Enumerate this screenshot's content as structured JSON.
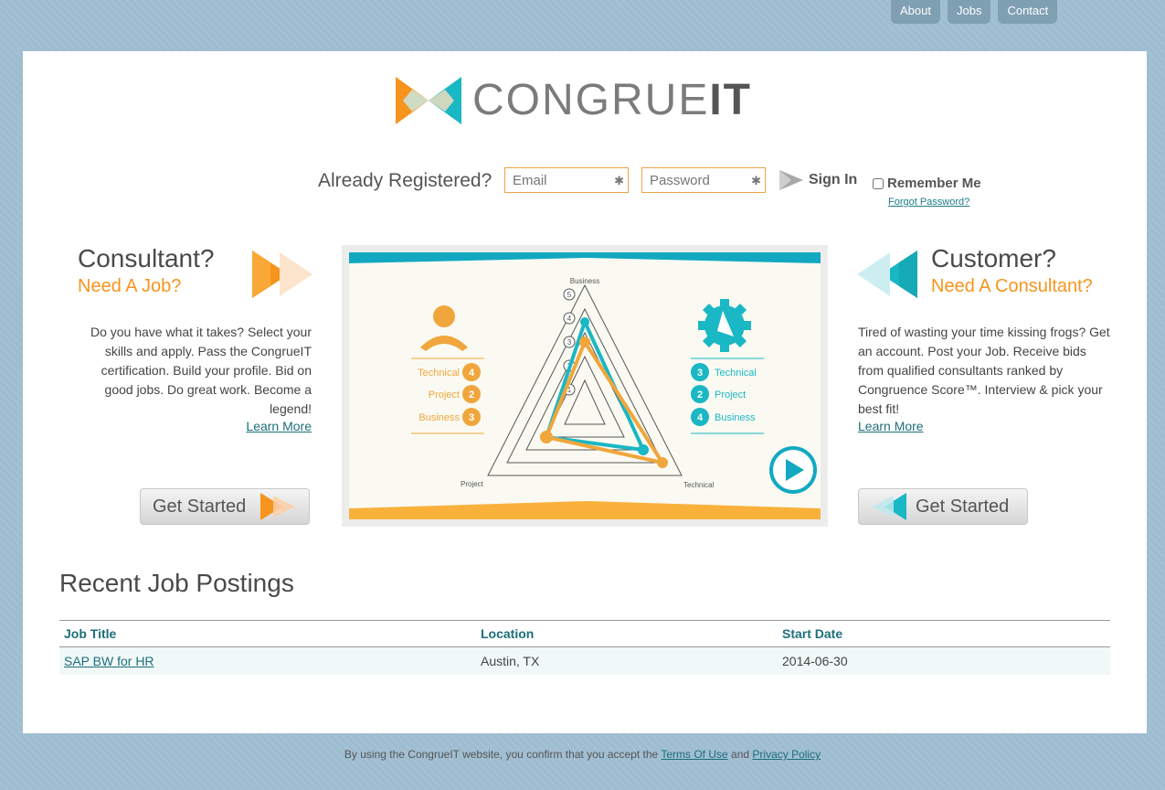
{
  "nav": [
    "About",
    "Jobs",
    "Contact"
  ],
  "logo": {
    "prefix": "CONGRUE",
    "suffix": "IT"
  },
  "login": {
    "prompt": "Already Registered?",
    "email_placeholder": "Email",
    "password_placeholder": "Password",
    "signin_label": "Sign In",
    "remember_label": "Remember Me",
    "forgot_label": "Forgot Password?"
  },
  "consultant": {
    "title": "Consultant?",
    "subtitle": "Need A Job?",
    "description": "Do you have what it takes? Select your skills and apply. Pass the CongrueIT certification. Build your profile. Bid on good jobs. Do great work. Become a legend!",
    "learn_more": "Learn More",
    "cta": "Get Started"
  },
  "customer": {
    "title": "Customer?",
    "subtitle": "Need A Consultant?",
    "description": "Tired of wasting your time kissing frogs? Get an account. Post your Job. Receive bids from qualified consultants ranked by Congruence Score™. Interview & pick your best fit!",
    "learn_more": "Learn More",
    "cta": "Get Started"
  },
  "video": {
    "axes": {
      "top": "Business",
      "left": "Project",
      "right": "Technical"
    },
    "ring_labels": [
      "1",
      "2",
      "3",
      "4",
      "5"
    ],
    "consultant_scores": [
      {
        "label": "Technical",
        "value": "4"
      },
      {
        "label": "Project",
        "value": "2"
      },
      {
        "label": "Business",
        "value": "3"
      }
    ],
    "customer_scores": [
      {
        "label": "Technical",
        "value": "3"
      },
      {
        "label": "Project",
        "value": "2"
      },
      {
        "label": "Business",
        "value": "4"
      }
    ]
  },
  "recent": {
    "title": "Recent Job Postings",
    "columns": [
      "Job Title",
      "Location",
      "Start Date"
    ],
    "rows": [
      [
        "SAP BW for HR",
        "Austin, TX",
        "2014-06-30"
      ]
    ]
  },
  "footer": {
    "text": "By using the CongrueIT website, you confirm that you accept the",
    "terms": "Terms Of Use",
    "and": "and",
    "privacy": "Privacy Policy"
  },
  "colors": {
    "orange": "#f7941d",
    "teal": "#1ab7c4",
    "link": "#1c6f7a"
  }
}
